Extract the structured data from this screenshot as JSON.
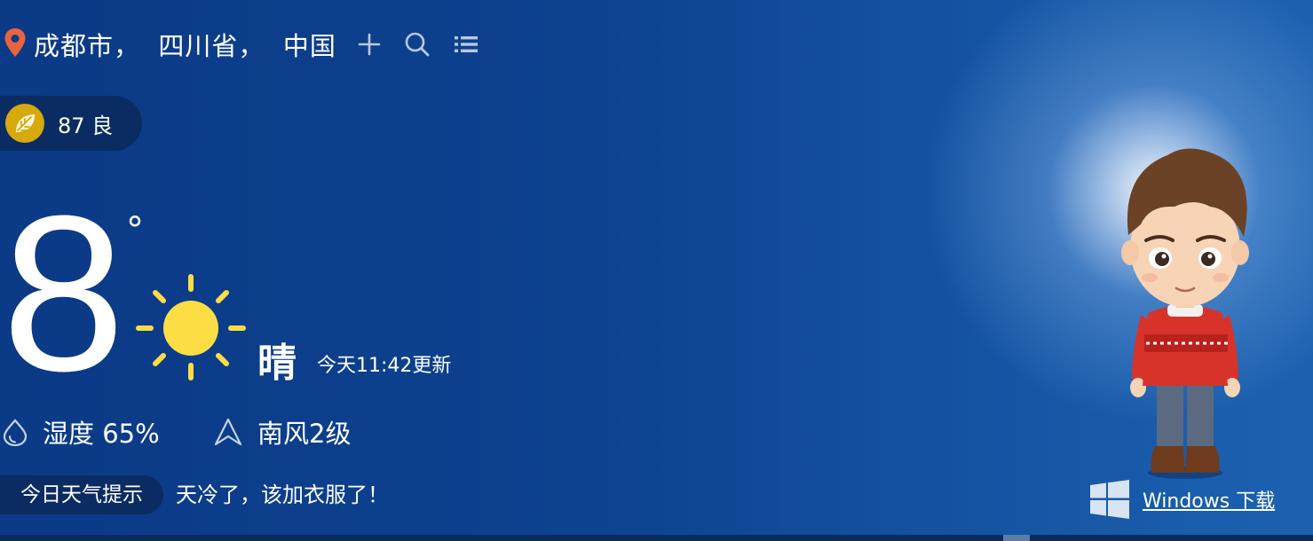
{
  "location": {
    "text": "成都市，  四川省，  中国"
  },
  "toolbar": {
    "add_icon": "plus-icon",
    "search_icon": "search-icon",
    "list_icon": "list-icon"
  },
  "aqi": {
    "value": "87",
    "level": "良",
    "text": "87 良",
    "color": "#d6a90d"
  },
  "weather": {
    "temperature": "8",
    "degree_symbol": "°",
    "condition": "晴",
    "updated": "今天11:42更新",
    "icon": "sun-icon",
    "sun_color": "#fddd44"
  },
  "details": {
    "humidity": "湿度 65%",
    "wind": "南风2级"
  },
  "tip": {
    "label": "今日天气提示",
    "text": "天冷了，该加衣服了！"
  },
  "download": {
    "label": "Windows 下载",
    "icon": "windows-logo-icon"
  },
  "colors": {
    "pill_bg": "#0a2c62",
    "pin": "#e8633f"
  }
}
